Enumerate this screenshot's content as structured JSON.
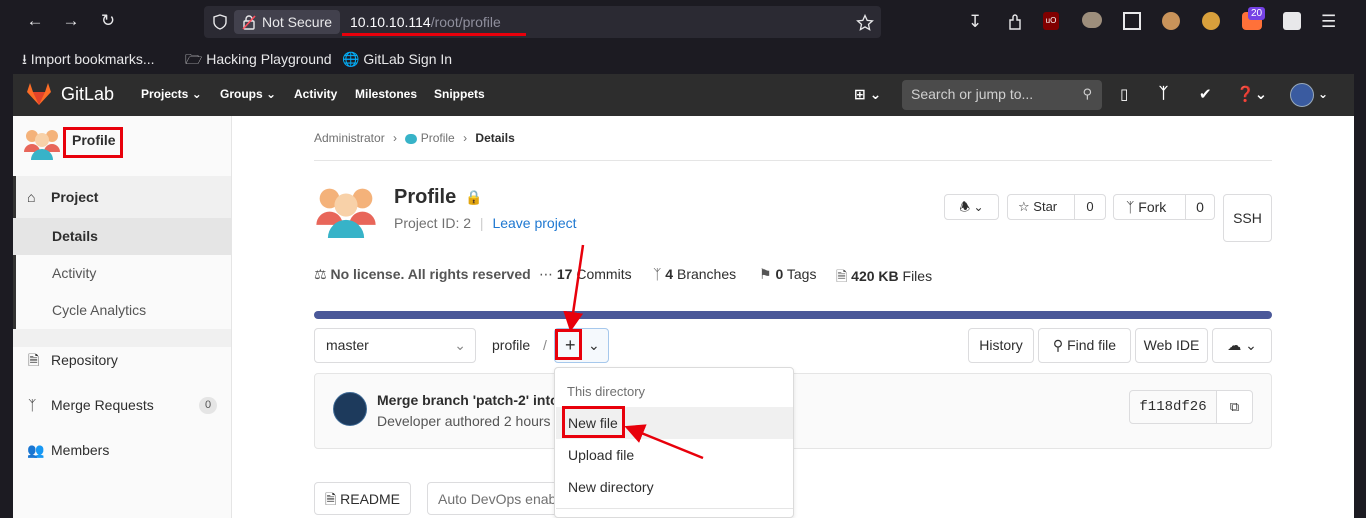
{
  "browser": {
    "security_label": "Not Secure",
    "url_host": "10.10.10.114",
    "url_path": "/root/profile",
    "bookmarks": [
      "Import bookmarks...",
      "Hacking Playground",
      "GitLab Sign In"
    ],
    "ext_badge": "20"
  },
  "gitlab_nav": {
    "logo_text": "GitLab",
    "menus": [
      "Projects",
      "Groups",
      "Activity",
      "Milestones",
      "Snippets"
    ],
    "search_placeholder": "Search or jump to..."
  },
  "sidebar": {
    "project_name": "Profile",
    "section": "Project",
    "subitems": [
      "Details",
      "Activity",
      "Cycle Analytics"
    ],
    "items": [
      "Repository",
      "Merge Requests",
      "Members"
    ],
    "mr_count": "0"
  },
  "breadcrumb": [
    "Administrator",
    "Profile",
    "Details"
  ],
  "project": {
    "title": "Profile",
    "project_id": "Project ID: 2",
    "leave": "Leave project",
    "star_label": "Star",
    "star_count": "0",
    "fork_label": "Fork",
    "fork_count": "0",
    "ssh_label": "SSH"
  },
  "stats": {
    "license": "No license. All rights reserved",
    "commits_num": "17",
    "commits_label": "Commits",
    "branches_num": "4",
    "branches_label": "Branches",
    "tags_num": "0",
    "tags_label": "Tags",
    "files_num": "420 KB",
    "files_label": "Files"
  },
  "repo_bar": {
    "branch": "master",
    "path": "profile",
    "separator": "/",
    "history": "History",
    "find_file": "Find file",
    "web_ide": "Web IDE"
  },
  "commit": {
    "message": "Merge branch 'patch-2' into '",
    "author_line": "Developer authored 2 hours a",
    "sha": "f118df26"
  },
  "dropdown": {
    "header": "This directory",
    "items": [
      "New file",
      "Upload file",
      "New directory"
    ]
  },
  "bottom": {
    "readme": "README",
    "autodevops": "Auto DevOps enab"
  },
  "colors": {
    "annotation_red": "#e8000b",
    "gitlab_navbar": "#2d2d2d",
    "link_blue": "#1f78d1",
    "progress_bar": "#4a5899"
  }
}
